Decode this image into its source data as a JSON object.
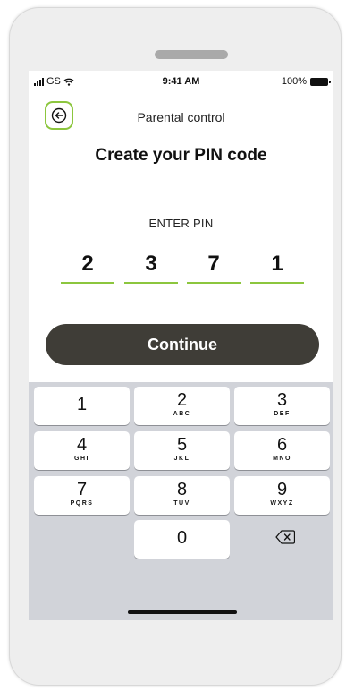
{
  "status_bar": {
    "carrier": "GS",
    "time": "9:41 AM",
    "battery": "100%"
  },
  "header": {
    "title": "Parental control"
  },
  "main": {
    "heading": "Create your PIN code",
    "pin_label": "ENTER PIN",
    "pin_digits": [
      "2",
      "3",
      "7",
      "1"
    ],
    "continue_label": "Continue"
  },
  "keypad": {
    "keys": [
      {
        "num": "1",
        "letters": ""
      },
      {
        "num": "2",
        "letters": "ABC"
      },
      {
        "num": "3",
        "letters": "DEF"
      },
      {
        "num": "4",
        "letters": "GHI"
      },
      {
        "num": "5",
        "letters": "JKL"
      },
      {
        "num": "6",
        "letters": "MNO"
      },
      {
        "num": "7",
        "letters": "PQRS"
      },
      {
        "num": "8",
        "letters": "TUV"
      },
      {
        "num": "9",
        "letters": "WXYZ"
      },
      {
        "num": "0",
        "letters": ""
      }
    ]
  },
  "colors": {
    "accent": "#8cc63e",
    "button": "#3f3d37",
    "keyboard_bg": "#d1d3d9"
  },
  "icons": {
    "back": "arrow-left-icon",
    "delete": "backspace-icon",
    "wifi": "wifi-icon",
    "signal": "signal-icon",
    "battery": "battery-icon"
  }
}
